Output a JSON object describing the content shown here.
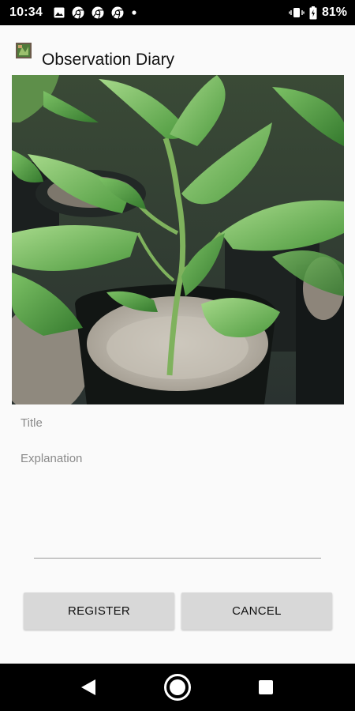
{
  "status_bar": {
    "time": "10:34",
    "battery": "81%",
    "icons": [
      "image-icon",
      "chrome-icon",
      "chrome-icon",
      "chrome-icon",
      "dot-icon",
      "vibrate-icon",
      "battery-icon"
    ]
  },
  "app_bar": {
    "title": "Observation Diary",
    "icon": "app-icon"
  },
  "photo": {
    "subject": "pepper seedling in pot"
  },
  "form": {
    "title_placeholder": "Title",
    "title_value": "",
    "explanation_placeholder": "Explanation",
    "explanation_value": ""
  },
  "buttons": {
    "register_label": "REGISTER",
    "cancel_label": "CANCEL"
  },
  "nav_bar": {
    "icons": [
      "back-icon",
      "home-icon",
      "recents-icon"
    ]
  },
  "colors": {
    "status_bar_bg": "#000000",
    "background": "#fafafa",
    "button_bg": "#d8d8d8",
    "hint_text": "#8a8a8a"
  }
}
